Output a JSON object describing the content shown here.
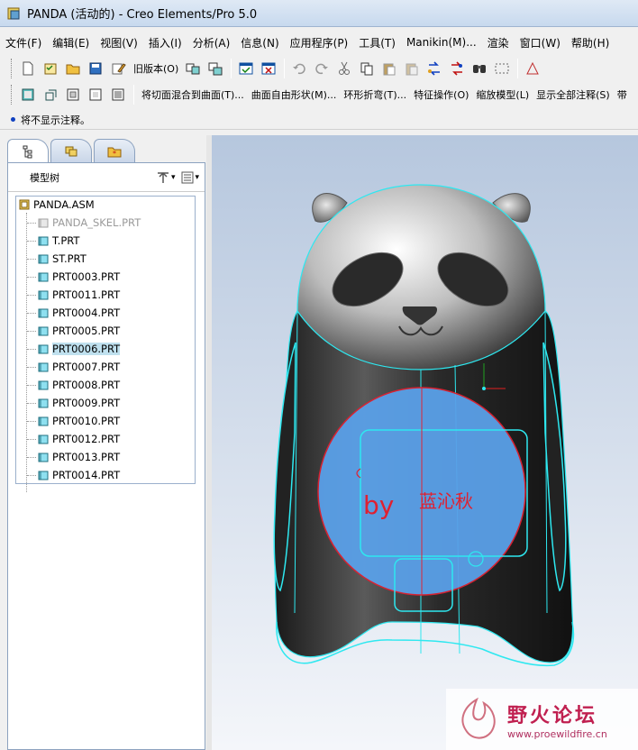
{
  "window": {
    "title": "PANDA (活动的) - Creo Elements/Pro 5.0"
  },
  "menu": [
    "文件(F)",
    "编辑(E)",
    "视图(V)",
    "插入(I)",
    "分析(A)",
    "信息(N)",
    "应用程序(P)",
    "工具(T)",
    "Manikin(M)...",
    "渲染",
    "窗口(W)",
    "帮助(H)"
  ],
  "toolbar1": {
    "legacy_label": "旧版本(O)"
  },
  "toolbar2": {
    "items": [
      "将切面混合到曲面(T)...",
      "曲面自由形状(M)...",
      "环形折弯(T)...",
      "特征操作(O)",
      "缩放模型(L)",
      "显示全部注释(S)",
      "带"
    ]
  },
  "message": "将不显示注释。",
  "model_tree": {
    "header": "模型树",
    "root": "PANDA.ASM",
    "items": [
      {
        "label": "PANDA_SKEL.PRT",
        "state": "gray"
      },
      {
        "label": "T.PRT",
        "state": ""
      },
      {
        "label": "ST.PRT",
        "state": ""
      },
      {
        "label": "PRT0003.PRT",
        "state": ""
      },
      {
        "label": "PRT0011.PRT",
        "state": ""
      },
      {
        "label": "PRT0004.PRT",
        "state": ""
      },
      {
        "label": "PRT0005.PRT",
        "state": ""
      },
      {
        "label": "PRT0006.PRT",
        "state": "selected"
      },
      {
        "label": "PRT0007.PRT",
        "state": ""
      },
      {
        "label": "PRT0008.PRT",
        "state": ""
      },
      {
        "label": "PRT0009.PRT",
        "state": ""
      },
      {
        "label": "PRT0010.PRT",
        "state": ""
      },
      {
        "label": "PRT0012.PRT",
        "state": ""
      },
      {
        "label": "PRT0013.PRT",
        "state": ""
      },
      {
        "label": "PRT0014.PRT",
        "state": ""
      }
    ]
  },
  "viewport": {
    "by_text": "by",
    "author_text": "蓝沁秋"
  },
  "watermark": {
    "cn": "野火论坛",
    "url": "www.proewildfire.cn"
  },
  "colors": {
    "accent_cyan": "#2ee8f0",
    "disc_blue": "#5aa0e8",
    "red_text": "#e02030",
    "selection": "#bfe0ee"
  }
}
